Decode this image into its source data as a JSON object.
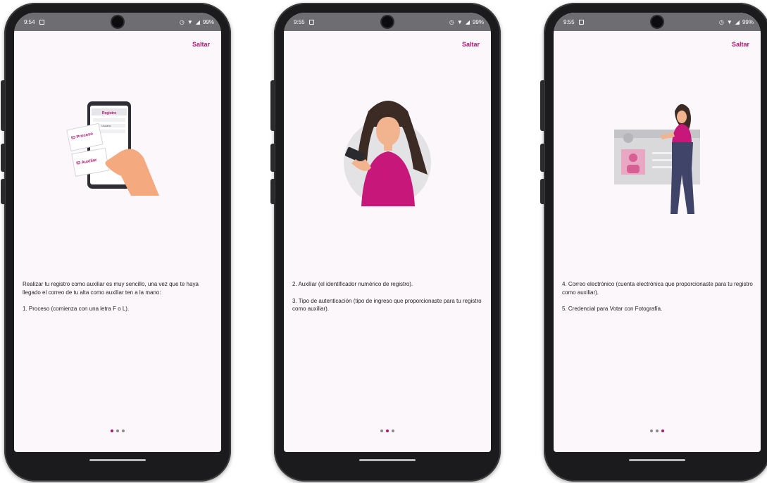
{
  "screens": [
    {
      "status": {
        "time": "9:54",
        "battery": "99%"
      },
      "skip_label": "Saltar",
      "illustration": "phone-registration-form-illustration",
      "paragraphs": [
        "Realizar tu registro como auxiliar es muy sencillo, una vez que te haya llegado el correo de tu alta como auxiliar ten a la mano:",
        "1. Proceso (comienza con una letra F o L)."
      ],
      "page_indicator": {
        "current": 1,
        "total": 3
      },
      "form_texts": {
        "title": "Registro",
        "proceso": "ID Proceso",
        "auxiliar": "ID Auxiliar",
        "field": "Usuario"
      }
    },
    {
      "status": {
        "time": "9:55",
        "battery": "99%"
      },
      "skip_label": "Saltar",
      "illustration": "woman-holding-phone-illustration",
      "paragraphs": [
        "2. Auxiliar (el identificador numérico de registro).",
        "3. Tipo de autenticación (tipo de ingreso que proporcionaste para tu registro como auxiliar)."
      ],
      "page_indicator": {
        "current": 2,
        "total": 3
      }
    },
    {
      "status": {
        "time": "9:55",
        "battery": "99%"
      },
      "skip_label": "Saltar",
      "illustration": "woman-with-id-card-illustration",
      "paragraphs": [
        "4. Correo electrónico (cuenta electrónica que proporcionaste para tu registro como auxiliar).",
        "5. Credencial para Votar con Fotografía."
      ],
      "page_indicator": {
        "current": 3,
        "total": 3
      }
    }
  ],
  "colors": {
    "accent": "#b0166f",
    "screen_bg": "#fcf7fb",
    "status_bg": "#6e6e72"
  }
}
